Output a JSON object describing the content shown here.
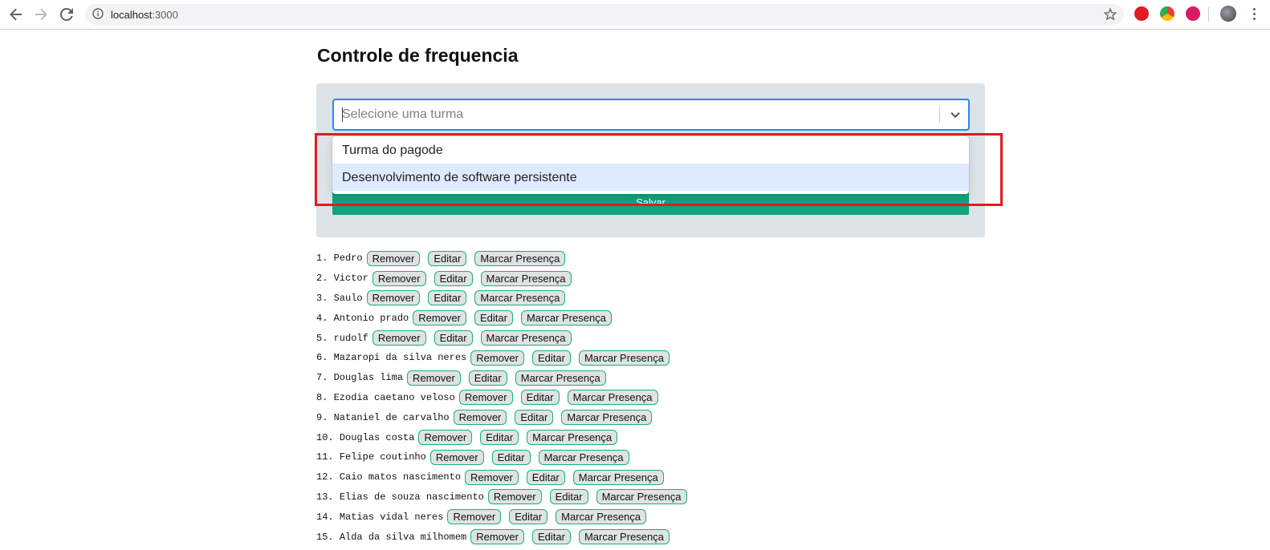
{
  "browser": {
    "url_host": "localhost",
    "url_port": ":3000"
  },
  "page": {
    "title": "Controle de frequencia",
    "select_placeholder": "Selecione uma turma",
    "save_label": "Salvar"
  },
  "dropdown": {
    "options": [
      {
        "label": "Turma do pagode",
        "focused": false
      },
      {
        "label": "Desenvolvimento de software persistente",
        "focused": true
      }
    ]
  },
  "actions": {
    "remove": "Remover",
    "edit": "Editar",
    "mark": "Marcar Presença"
  },
  "students": [
    {
      "num": "1.",
      "name": "Pedro"
    },
    {
      "num": "2.",
      "name": "Victor"
    },
    {
      "num": "3.",
      "name": "Saulo"
    },
    {
      "num": "4.",
      "name": "Antonio prado"
    },
    {
      "num": "5.",
      "name": "rudolf"
    },
    {
      "num": "6.",
      "name": "Mazaropi da silva neres"
    },
    {
      "num": "7.",
      "name": "Douglas lima"
    },
    {
      "num": "8.",
      "name": "Ezodia caetano veloso"
    },
    {
      "num": "9.",
      "name": "Nataniel de carvalho"
    },
    {
      "num": "10.",
      "name": "Douglas costa"
    },
    {
      "num": "11.",
      "name": "Felipe coutinho"
    },
    {
      "num": "12.",
      "name": "Caio matos nascimento"
    },
    {
      "num": "13.",
      "name": "Elias de souza nascimento"
    },
    {
      "num": "14.",
      "name": "Matias vidal neres"
    },
    {
      "num": "15.",
      "name": "Alda da silva milhomem"
    }
  ],
  "colors": {
    "accent": "#10a37f",
    "highlight": "#e01b24",
    "focus_border": "#2684ff"
  }
}
